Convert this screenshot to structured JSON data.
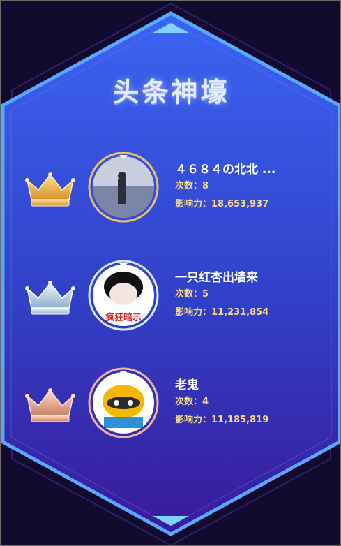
{
  "header": {
    "title": "头条神壕"
  },
  "ranking": [
    {
      "rank_icon": "gold-crown-icon",
      "avatar": "person-in-snow-photo",
      "name": "４６８４の北北 ...",
      "count_label": "次数：",
      "count": "8",
      "influence_label": "影响力：",
      "influence": "18,653,937"
    },
    {
      "rank_icon": "silver-crown-icon",
      "avatar": "cartoon-face-photo",
      "avatar_caption": "疯狂暗示",
      "name": "一只红杏出墙来",
      "count_label": "次数：",
      "count": "5",
      "influence_label": "影响力：",
      "influence": "11,231,854"
    },
    {
      "rank_icon": "bronze-crown-icon",
      "avatar": "raccoon-mascot-photo",
      "name": "老鬼",
      "count_label": "次数：",
      "count": "4",
      "influence_label": "影响力：",
      "influence": "11,185,819"
    }
  ],
  "colors": {
    "background": "#130b2e",
    "panel_top": "#3a5ef0",
    "panel_bottom": "#3a1c9c",
    "panel_border": "#56a6ff",
    "gold": "#f4c75a",
    "silver": "#bcd6ea",
    "bronze": "#eab39a",
    "stat_text": "#f6d98a"
  }
}
